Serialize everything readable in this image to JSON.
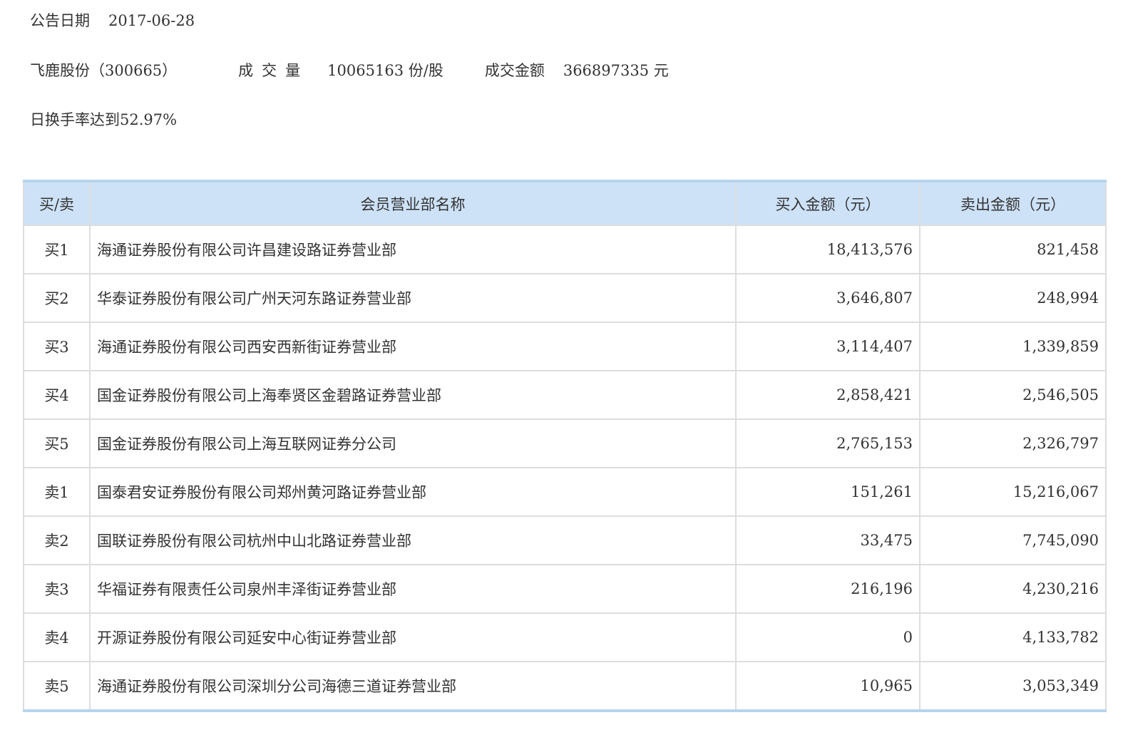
{
  "header": {
    "date_label": "公告日期",
    "date_value": "2017-06-28",
    "stock_name": "飞鹿股份（300665）",
    "volume_label": "成交量",
    "volume_value": "10065163",
    "volume_unit": "份/股",
    "amount_label": "成交金额",
    "amount_value": "366897335",
    "amount_unit": "元",
    "reason": "日换手率达到52.97%"
  },
  "table": {
    "columns": [
      "买/卖",
      "会员营业部名称",
      "买入金额（元）",
      "卖出金额（元）"
    ],
    "rows": [
      {
        "side": "买1",
        "name": "海通证券股份有限公司许昌建设路证券营业部",
        "buy": "18,413,576",
        "sell": "821,458"
      },
      {
        "side": "买2",
        "name": "华泰证券股份有限公司广州天河东路证券营业部",
        "buy": "3,646,807",
        "sell": "248,994"
      },
      {
        "side": "买3",
        "name": "海通证券股份有限公司西安西新街证券营业部",
        "buy": "3,114,407",
        "sell": "1,339,859"
      },
      {
        "side": "买4",
        "name": "国金证券股份有限公司上海奉贤区金碧路证券营业部",
        "buy": "2,858,421",
        "sell": "2,546,505"
      },
      {
        "side": "买5",
        "name": "国金证券股份有限公司上海互联网证券分公司",
        "buy": "2,765,153",
        "sell": "2,326,797"
      },
      {
        "side": "卖1",
        "name": "国泰君安证券股份有限公司郑州黄河路证券营业部",
        "buy": "151,261",
        "sell": "15,216,067"
      },
      {
        "side": "卖2",
        "name": "国联证券股份有限公司杭州中山北路证券营业部",
        "buy": "33,475",
        "sell": "7,745,090"
      },
      {
        "side": "卖3",
        "name": "华福证券有限责任公司泉州丰泽街证券营业部",
        "buy": "216,196",
        "sell": "4,230,216"
      },
      {
        "side": "卖4",
        "name": "开源证券股份有限公司延安中心街证券营业部",
        "buy": "0",
        "sell": "4,133,782"
      },
      {
        "side": "卖5",
        "name": "海通证券股份有限公司深圳分公司海德三道证券营业部",
        "buy": "10,965",
        "sell": "3,053,349"
      }
    ]
  }
}
